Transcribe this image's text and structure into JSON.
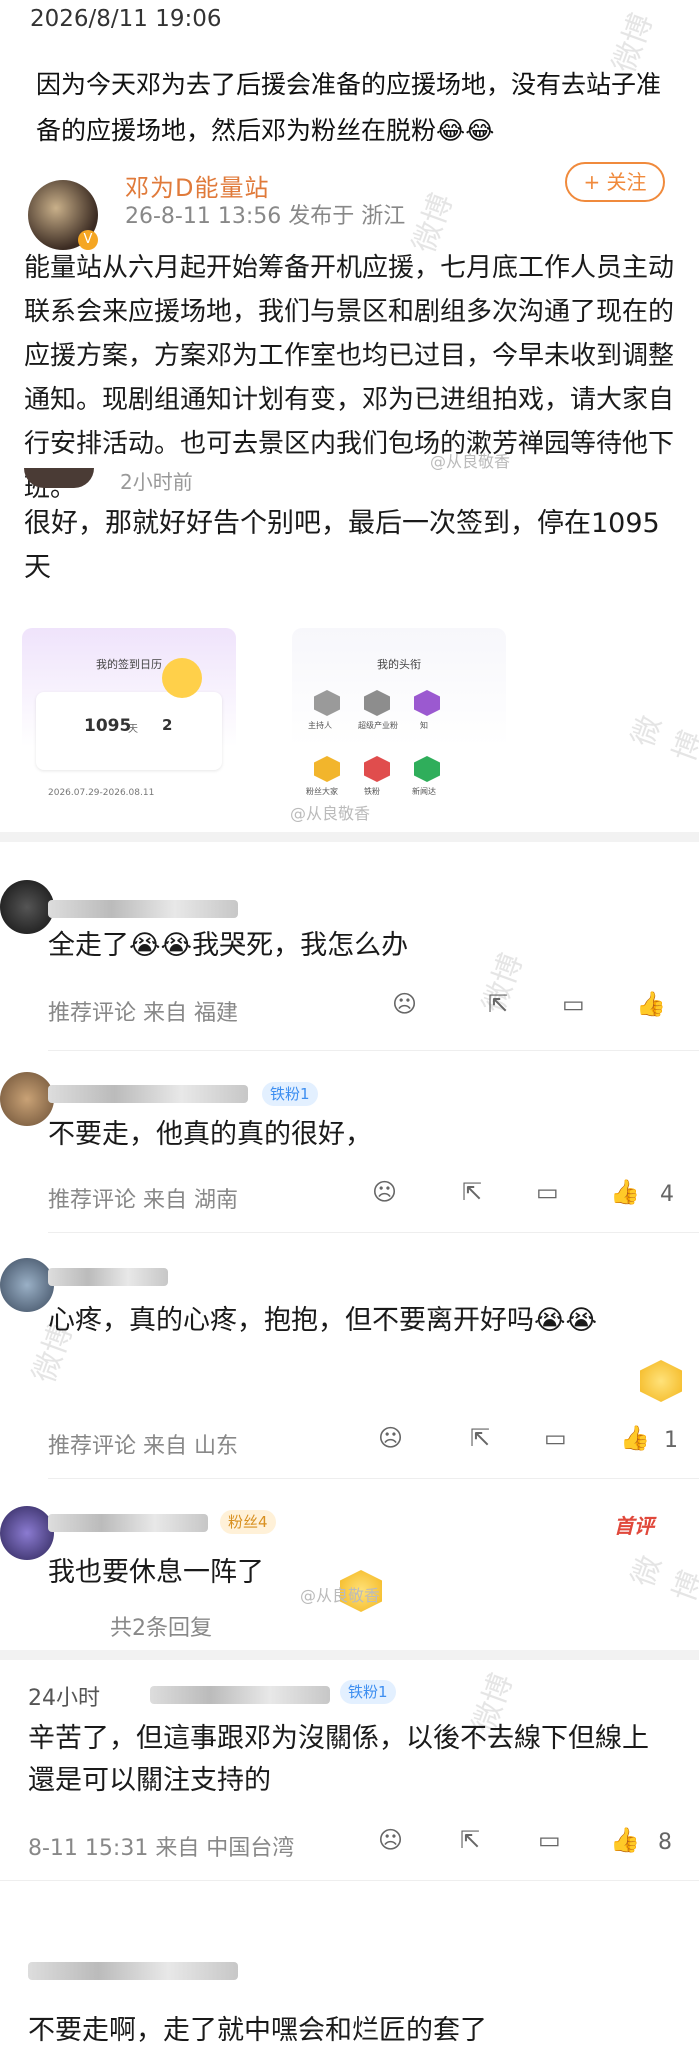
{
  "timestamp": "2026/8/11 19:06",
  "intro": "因为今天邓为去了后援会准备的应援场地，没有去站子准备的应援场地，然后邓为粉丝在脱粉😂😂",
  "post": {
    "name": "邓为D能量站",
    "meta": "26-8-11 13:56  发布于 浙江",
    "follow_label": "+ 关注",
    "body": "能量站从六月起开始筹备开机应援，七月底工作人员主动联系会来应援场地，我们与景区和剧组多次沟通了现在的应援方案，方案邓为工作室也均已过目，今早未收到调整通知。现剧组通知计划有变，邓为已进组拍戏，请大家自行安排活动。也可去景区内我们包场的漱芳禅园等待他下班。"
  },
  "repost": {
    "time": "2小时前",
    "body": "很好，那就好好告个别吧，最后一次签到，停在1095天",
    "shot1": {
      "title": "我的签到日历",
      "days": "1095",
      "days_unit": "天",
      "sub": "2",
      "range": "2026.07.29-2026.08.11"
    },
    "shot2": {
      "title": "我的头衔",
      "badges": [
        "主持人",
        "超级产业粉",
        "知",
        "粉丝大家",
        "铁粉",
        "新闻达"
      ]
    }
  },
  "watermarks": {
    "weibo": "微博",
    "handle": "@从良敬香"
  },
  "comments": [
    {
      "text": "全走了😭😭我哭死，我怎么办",
      "meta": "推荐评论  来自 福建",
      "likes": "",
      "badge": ""
    },
    {
      "text": "不要走，他真的真的很好，",
      "meta": "推荐评论  来自 湖南",
      "likes": "4",
      "badge": "铁粉1"
    },
    {
      "text": "心疼，真的心疼，抱抱，但不要离开好吗😭😭",
      "meta": "推荐评论  来自 山东",
      "likes": "1",
      "badge": ""
    },
    {
      "text": "我也要休息一阵了",
      "meta": "",
      "likes": "",
      "badge": "粉丝4",
      "tag": "首评",
      "replies": "共2条回复"
    },
    {
      "text": "辛苦了，但這事跟邓为沒關係，以後不去線下但線上還是可以關注支持的",
      "meta": "8-11 15:31  来自 中国台湾",
      "likes": "8",
      "badge": "铁粉1",
      "name_tail": "24小时"
    },
    {
      "text": "不要走啊，走了就中嘿会和烂匠的套了",
      "meta": "",
      "likes": "",
      "badge": ""
    }
  ],
  "colors": {
    "accent": "#f08a3c",
    "fan_badge": "#3d8ef0",
    "top_tag": "#e0483b"
  },
  "icons": [
    "dislike-icon",
    "share-icon",
    "comment-icon",
    "like-icon",
    "verified-icon"
  ]
}
